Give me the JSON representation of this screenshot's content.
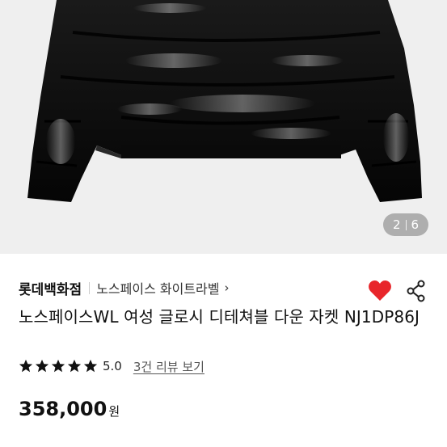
{
  "gallery": {
    "current": "2",
    "total": "6"
  },
  "store": {
    "name": "롯데백화점",
    "brand": "노스페이스 화이트라벨",
    "chevron": "›"
  },
  "product": {
    "title": "노스페이스WL 여성 글로시 디테쳐블 다운 자켓 NJ1DP86J",
    "rating": "5.0",
    "stars": 5,
    "reviews": "3건 리뷰 보기",
    "price": "358,000",
    "currency": "원"
  },
  "colors": {
    "heart": "#e8262b",
    "star": "#111111",
    "indicator_bg": "#8a8a8a"
  },
  "icons": [
    "heart-icon",
    "share-icon",
    "star-icon"
  ]
}
